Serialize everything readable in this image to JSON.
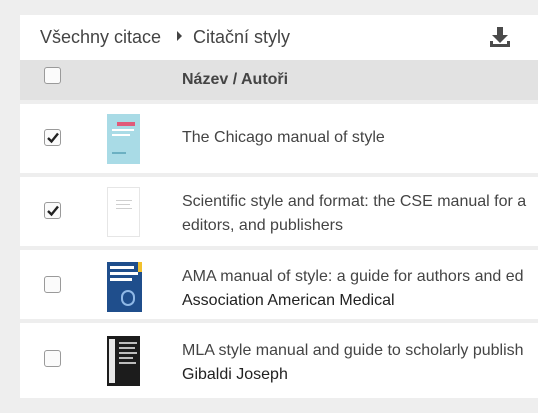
{
  "breadcrumb": {
    "all_citations": "Všechny citace",
    "citation_styles": "Citační styly"
  },
  "toolbar": {
    "download_icon": "download-icon"
  },
  "table": {
    "header_label": "Název / Autoři",
    "select_all_checked": false,
    "rows": [
      {
        "title": "The Chicago manual of style",
        "title_line2": "",
        "author": "",
        "checked": true,
        "cover_color": "#a9dbe6"
      },
      {
        "title": "Scientific style and format: the CSE manual for a",
        "title_line2": "editors, and publishers",
        "author": "",
        "checked": true,
        "cover_color": "#ffffff"
      },
      {
        "title": "AMA manual of style: a guide for authors and ed",
        "title_line2": "",
        "author": "Association American Medical",
        "checked": false,
        "cover_color": "#1f4e8c"
      },
      {
        "title": "MLA style manual and guide to scholarly publish",
        "title_line2": "",
        "author": "Gibaldi Joseph",
        "checked": false,
        "cover_color": "#1c1c1c"
      }
    ]
  },
  "colors": {
    "background": "#eeeeee",
    "header_bg": "#e2e2e2",
    "row_bg": "#ffffff"
  }
}
